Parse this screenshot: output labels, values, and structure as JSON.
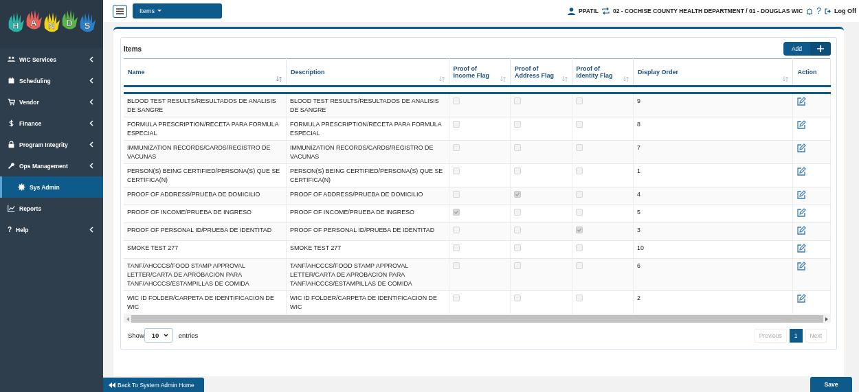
{
  "sidebar": {
    "logo_letters": [
      "H",
      "A",
      "N",
      "D",
      "S"
    ],
    "items": [
      {
        "label": "WIC Services",
        "has_submenu": true,
        "selected": false
      },
      {
        "label": "Scheduling",
        "has_submenu": true,
        "selected": false
      },
      {
        "label": "Vendor",
        "has_submenu": true,
        "selected": false
      },
      {
        "label": "Finance",
        "has_submenu": true,
        "selected": false
      },
      {
        "label": "Program Integrity",
        "has_submenu": true,
        "selected": false
      },
      {
        "label": "Ops Management",
        "has_submenu": true,
        "selected": false
      },
      {
        "label": "Sys Admin",
        "has_submenu": false,
        "selected": true
      },
      {
        "label": "Reports",
        "has_submenu": false,
        "selected": false
      },
      {
        "label": "Help",
        "glyph": "?",
        "has_submenu": true,
        "selected": false
      }
    ]
  },
  "top_bar": {
    "view_menu": "Items",
    "user": "PPATIL",
    "agency": "02 - COCHISE COUNTY HEALTH DEPARTMENT / 01 - DOUGLAS WIC",
    "help": "?",
    "logout": "Log Off"
  },
  "card": {
    "title": "Items",
    "add_button": "Add"
  },
  "table": {
    "columns": [
      {
        "label": "Name",
        "sortable": true
      },
      {
        "label": "Description",
        "sortable": true
      },
      {
        "label": "Proof of Income Flag",
        "sortable": true
      },
      {
        "label": "Proof of Address Flag",
        "sortable": true
      },
      {
        "label": "Proof of Identity Flag",
        "sortable": true
      },
      {
        "label": "Display Order",
        "sortable": true
      },
      {
        "label": "Action",
        "sortable": false
      }
    ],
    "rows": [
      {
        "name": "BLOOD TEST RESULTS/RESULTADOS DE ANALISIS DE SANGRE",
        "description": "BLOOD TEST RESULTS/RESULTADOS DE ANALISIS DE SANGRE",
        "income": false,
        "address": false,
        "identity": false,
        "order": "9"
      },
      {
        "name": "FORMULA PRESCRIPTION/RECETA PARA FORMULA ESPECIAL",
        "description": "FORMULA PRESCRIPTION/RECETA PARA FORMULA ESPECIAL",
        "income": false,
        "address": false,
        "identity": false,
        "order": "8"
      },
      {
        "name": "IMMUNIZATION RECORDS/CARDS/REGISTRO DE VACUNAS",
        "description": "IMMUNIZATION RECORDS/CARDS/REGISTRO DE VACUNAS",
        "income": false,
        "address": false,
        "identity": false,
        "order": "7"
      },
      {
        "name": "PERSON(S) BEING CERTIFIED/PERSONA(S) QUE SE CERTIFICA(N)",
        "description": "PERSON(S) BEING CERTIFIED/PERSONA(S) QUE SE CERTIFICA(N)",
        "income": false,
        "address": false,
        "identity": false,
        "order": "1"
      },
      {
        "name": "PROOF OF ADDRESS/PRUEBA DE DOMICILIO",
        "description": "PROOF OF ADDRESS/PRUEBA DE DOMICILIO",
        "income": false,
        "address": true,
        "identity": false,
        "order": "4"
      },
      {
        "name": "PROOF OF INCOME/PRUEBA DE INGRESO",
        "description": "PROOF OF INCOME/PRUEBA DE INGRESO",
        "income": true,
        "address": false,
        "identity": false,
        "order": "5"
      },
      {
        "name": "PROOF OF PERSONAL ID/PRUEBA DE IDENTITAD",
        "description": "PROOF OF PERSONAL ID/PRUEBA DE IDENTITAD",
        "income": false,
        "address": false,
        "identity": true,
        "order": "3"
      },
      {
        "name": "SMOKE TEST 277",
        "description": "SMOKE TEST 277",
        "income": false,
        "address": false,
        "identity": false,
        "order": "10"
      },
      {
        "name": "TANF/AHCCCS/FOOD STAMP APPROVAL LETTER/CARTA DE APROBACION PARA TANF/AHCCCS/ESTAMPILLAS DE COMIDA",
        "description": "TANF/AHCCCS/FOOD STAMP APPROVAL LETTER/CARTA DE APROBACION PARA TANF/AHCCCS/ESTAMPILLAS DE COMIDA",
        "income": false,
        "address": false,
        "identity": false,
        "order": "6"
      },
      {
        "name": "WIC ID FOLDER/CARPETA DE IDENTIFICACION DE WIC",
        "description": "WIC ID FOLDER/CARPETA DE IDENTIFICACION DE WIC",
        "income": false,
        "address": false,
        "identity": false,
        "order": "2"
      }
    ]
  },
  "table_footer": {
    "show_label": "Show",
    "page_length": "10",
    "entries_label": "entries",
    "previous": "Previous",
    "pages": [
      {
        "label": "1",
        "selected": true
      }
    ],
    "next": "Next"
  },
  "bottom_bar": {
    "back_button": "Back To System Admin Home",
    "save_button": "Save"
  }
}
